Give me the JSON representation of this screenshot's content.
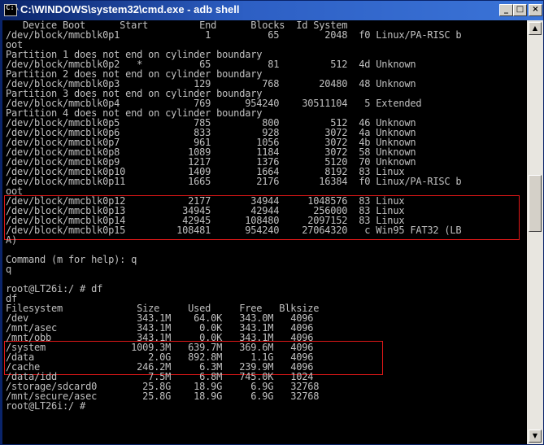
{
  "window": {
    "title": "C:\\WINDOWS\\system32\\cmd.exe - adb shell",
    "icon_label": "C:\\"
  },
  "controls": {
    "minimize": "_",
    "maximize": "□",
    "close": "×"
  },
  "scrollbar": {
    "up": "▲",
    "down": "▼"
  },
  "console": {
    "lines": [
      "   Device Boot      Start         End      Blocks  Id System",
      "/dev/block/mmcblk0p1               1          65        2048  f0 Linux/PA-RISC b",
      "oot",
      "Partition 1 does not end on cylinder boundary",
      "/dev/block/mmcblk0p2   *          65          81         512  4d Unknown",
      "Partition 2 does not end on cylinder boundary",
      "/dev/block/mmcblk0p3             129         768       20480  48 Unknown",
      "Partition 3 does not end on cylinder boundary",
      "/dev/block/mmcblk0p4             769      954240    30511104   5 Extended",
      "Partition 4 does not end on cylinder boundary",
      "/dev/block/mmcblk0p5             785         800         512  46 Unknown",
      "/dev/block/mmcblk0p6             833         928        3072  4a Unknown",
      "/dev/block/mmcblk0p7             961        1056        3072  4b Unknown",
      "/dev/block/mmcblk0p8            1089        1184        3072  58 Unknown",
      "/dev/block/mmcblk0p9            1217        1376        5120  70 Unknown",
      "/dev/block/mmcblk0p10           1409        1664        8192  83 Linux",
      "/dev/block/mmcblk0p11           1665        2176       16384  f0 Linux/PA-RISC b",
      "oot",
      "/dev/block/mmcblk0p12           2177       34944     1048576  83 Linux",
      "/dev/block/mmcblk0p13          34945       42944      256000  83 Linux",
      "/dev/block/mmcblk0p14          42945      108480     2097152  83 Linux",
      "/dev/block/mmcblk0p15         108481      954240    27064320   c Win95 FAT32 (LB",
      "A)",
      "",
      "Command (m for help): q",
      "q",
      "",
      "root@LT26i:/ # df",
      "df",
      "Filesystem             Size     Used     Free   Blksize",
      "/dev                   343.1M    64.0K   343.0M   4096",
      "/mnt/asec              343.1M     0.0K   343.1M   4096",
      "/mnt/obb               343.1M     0.0K   343.1M   4096",
      "/system               1009.3M   639.7M   369.6M   4096",
      "/data                    2.0G   892.8M     1.1G   4096",
      "/cache                 246.2M     6.3M   239.9M   4096",
      "/data/idd                7.5M     6.8M   745.0K   1024",
      "/storage/sdcard0        25.8G    18.9G     6.9G   32768",
      "/mnt/secure/asec        25.8G    18.9G     6.9G   32768",
      "root@LT26i:/ #"
    ]
  }
}
